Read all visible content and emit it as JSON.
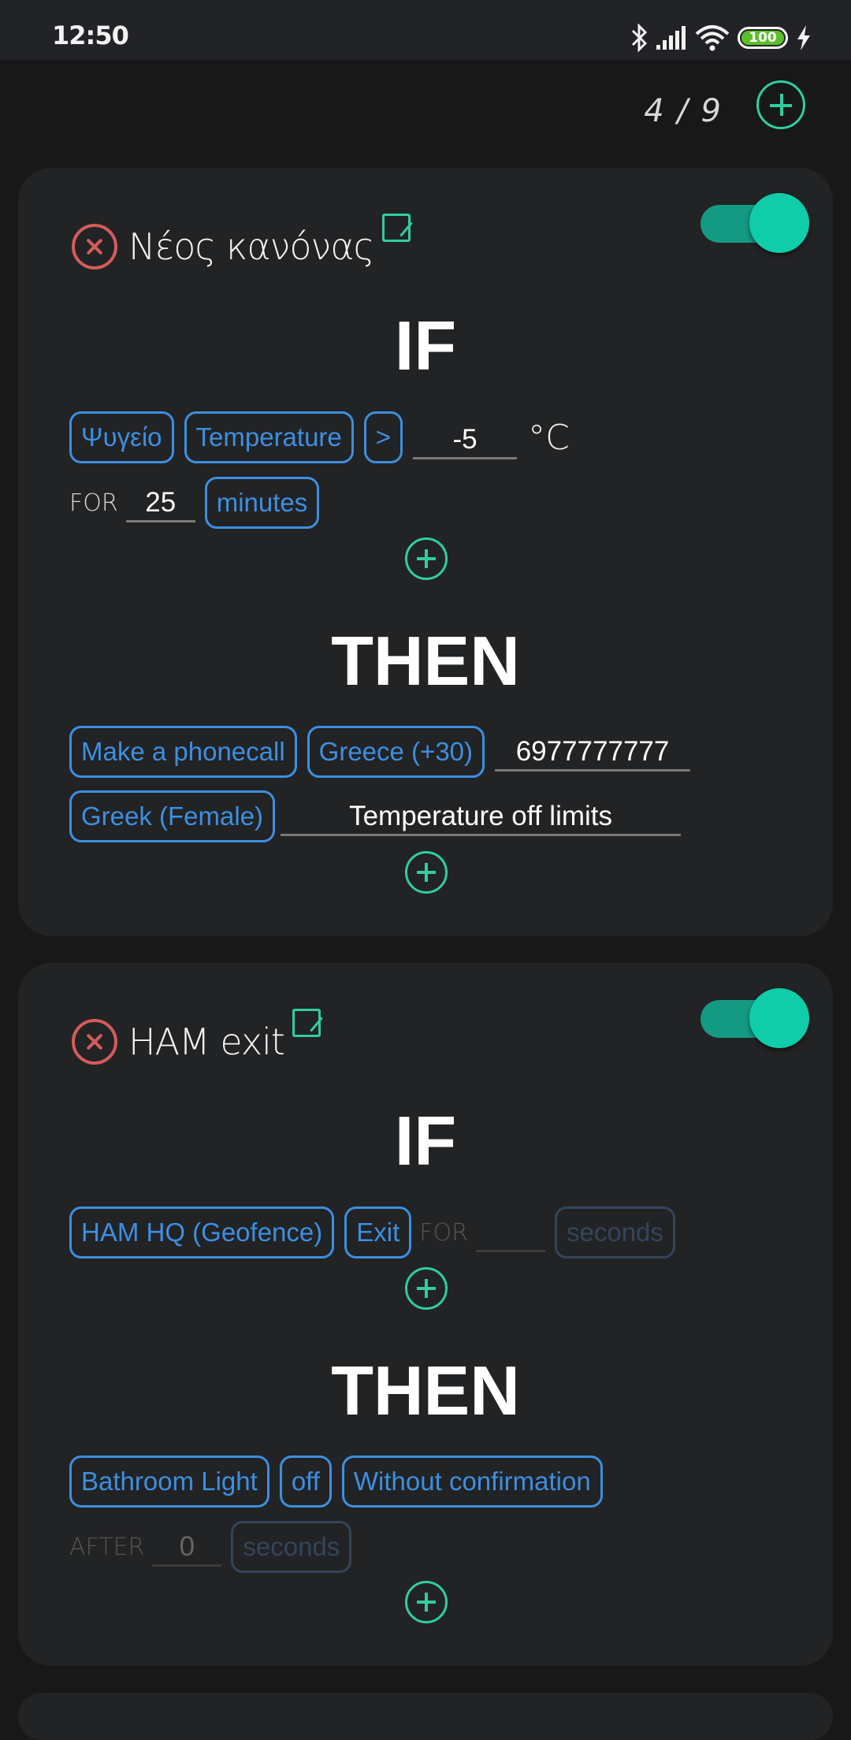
{
  "status_bar": {
    "time": "12:50",
    "icons": [
      "bluetooth-icon",
      "signal-icon",
      "wifi-icon",
      "battery-icon",
      "charging-icon"
    ],
    "battery_level": "100"
  },
  "header": {
    "counter": "4 / 9",
    "add_rule_icon": "plus-icon"
  },
  "colors": {
    "accent": "#2fcea0",
    "chip_blue": "#3d8fe0",
    "delete_red": "#d45c5a",
    "toggle_on": "#10cdaa",
    "card_bg": "#222325",
    "page_bg": "#181818"
  },
  "rules": [
    {
      "name": "Νέος κανόνας",
      "enabled": true,
      "if_title": "IF",
      "then_title": "THEN",
      "conditions": {
        "device": "Ψυγείο",
        "attribute": "Temperature",
        "operator": ">",
        "value": "-5",
        "unit": "°C",
        "for_label": "FOR",
        "for_value": "25",
        "for_unit": "minutes"
      },
      "actions": {
        "action": "Make a phonecall",
        "country": "Greece (+30)",
        "phone": "6977777777",
        "voice": "Greek (Female)",
        "message": "Temperature off limits"
      }
    },
    {
      "name": "HAM exit",
      "enabled": true,
      "if_title": "IF",
      "then_title": "THEN",
      "conditions": {
        "device": "HAM HQ (Geofence)",
        "event": "Exit",
        "for_label": "FOR",
        "for_value": "",
        "for_unit": "seconds"
      },
      "actions": {
        "device": "Bathroom Light",
        "state": "off",
        "confirmation": "Without confirmation",
        "after_label": "AFTER",
        "after_value": "0",
        "after_unit": "seconds"
      }
    }
  ]
}
